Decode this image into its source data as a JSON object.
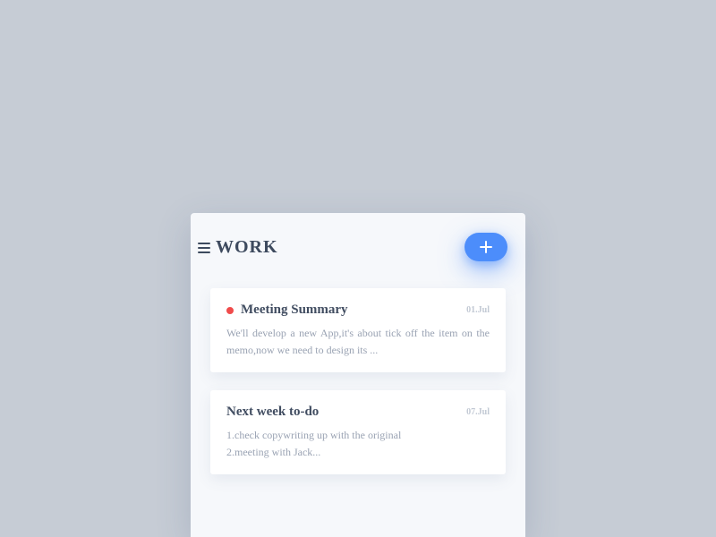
{
  "header": {
    "title": "WORK"
  },
  "notes": [
    {
      "title": "Meeting Summary",
      "date": "01.Jul",
      "has_dot": true,
      "body": "We'll develop a new App,it's about tick off the item on the memo,now we need to design its ..."
    },
    {
      "title": "Next week to-do",
      "date": "07.Jul",
      "has_dot": false,
      "body": "1.check copywriting up with the original\n2.meeting with Jack..."
    }
  ],
  "colors": {
    "accent": "#4c8dfb",
    "dot": "#f04b4b"
  }
}
